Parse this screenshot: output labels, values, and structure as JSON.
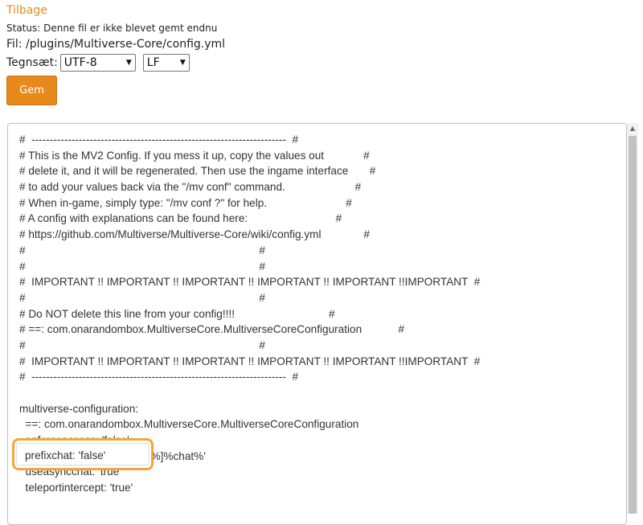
{
  "header": {
    "back_label": "Tilbage",
    "status": "Status: Denne fil er ikke blevet gemt endnu",
    "file": "Fil: /plugins/Multiverse-Core/config.yml",
    "charset_label": "Tegnsæt:",
    "charset_value": "UTF-8",
    "eol_value": "LF",
    "save_label": "Gem"
  },
  "editor": {
    "lines": [
      "#  ----------------------------------------------------------------------  #",
      "# This is the MV2 Config. If you mess it up, copy the values out             #",
      "# delete it, and it will be regenerated. Then use the ingame interface       #",
      "# to add your values back via the \"/mv conf\" command.                       #",
      "# When in-game, simply type: \"/mv conf ?\" for help.                          #",
      "# A config with explanations can be found here:                             #",
      "# https://github.com/Multiverse/Multiverse-Core/wiki/config.yml              #",
      "#                                                                             #",
      "#                                                                             #",
      "#  IMPORTANT !! IMPORTANT !! IMPORTANT !! IMPORTANT !! IMPORTANT !!IMPORTANT  #",
      "#                                                                             #",
      "# Do NOT delete this line from your config!!!!                               #",
      "# ==: com.onarandombox.MultiverseCore.MultiverseCoreConfiguration            #",
      "#                                                                             #",
      "#  IMPORTANT !! IMPORTANT !! IMPORTANT !! IMPORTANT !! IMPORTANT !!IMPORTANT  #",
      "#  ----------------------------------------------------------------------  #",
      "",
      "multiverse-configuration:",
      "  ==: com.onarandombox.MultiverseCore.MultiverseCoreConfiguration",
      "  enforceaccess: 'false'",
      "  prefixchatformat: '[%world%]%chat%'",
      "  useasyncchat: 'true'",
      "  teleportintercept: 'true'"
    ],
    "highlighted_line": "prefixchat: 'false'"
  }
}
